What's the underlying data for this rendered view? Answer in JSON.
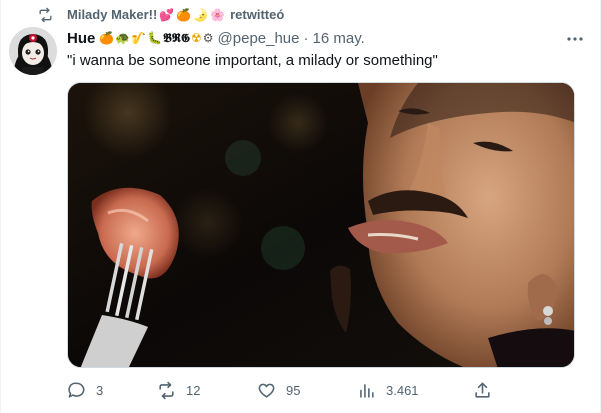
{
  "retweet": {
    "icon": "retweet-icon",
    "user": "Milady Maker!!",
    "emojis": [
      "💕",
      "🍊",
      "🌛",
      "🌸"
    ],
    "suffix": "retwitteó"
  },
  "author": {
    "display_name": "Hue",
    "name_emojis": [
      "🍊",
      "🐢",
      "🎷",
      "🐛",
      "𝕭𝕽𝕲",
      "☢",
      "⚙"
    ],
    "handle": "@pepe_hue",
    "separator": "·",
    "date": "16 may."
  },
  "tweet": {
    "text": "\"i wanna be someone important, a milady or something\""
  },
  "more": {
    "icon": "more-horizontal-icon"
  },
  "actions": {
    "reply": {
      "icon": "reply-icon",
      "count": "3"
    },
    "retweet": {
      "icon": "retweet-icon",
      "count": "12"
    },
    "like": {
      "icon": "heart-icon",
      "count": "95"
    },
    "views": {
      "icon": "analytics-icon",
      "count": "3.461"
    },
    "share": {
      "icon": "share-icon"
    }
  },
  "colors": {
    "text_primary": "#0f1419",
    "text_secondary": "#536471",
    "border": "#cfd9de"
  }
}
